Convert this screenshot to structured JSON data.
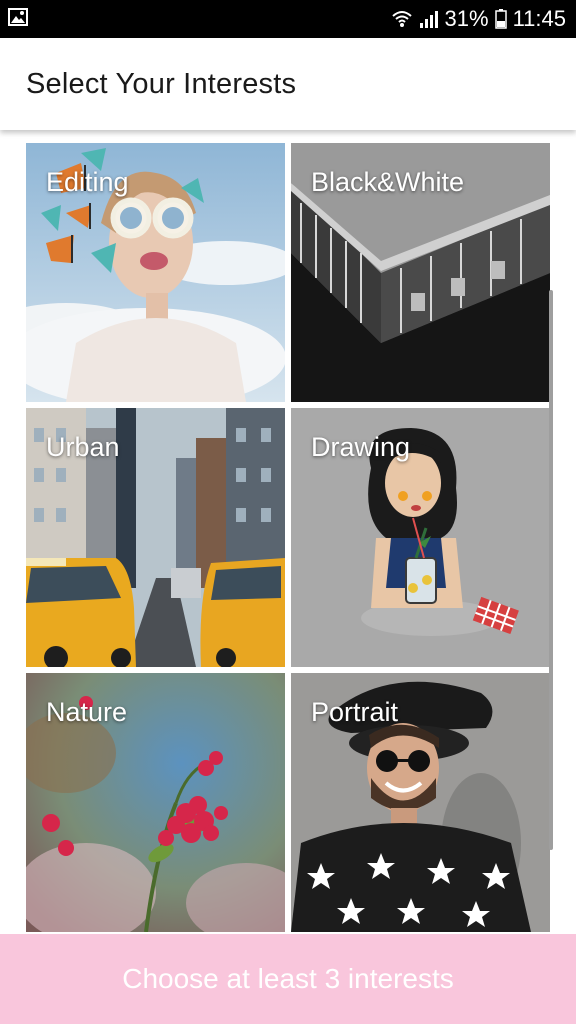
{
  "status_bar": {
    "battery": "31%",
    "time": "11:45",
    "icons": [
      "gallery-icon",
      "wifi-icon",
      "signal-icon",
      "battery-icon"
    ]
  },
  "header": {
    "title": "Select Your Interests"
  },
  "interests": [
    {
      "label": "Editing"
    },
    {
      "label": "Black&White"
    },
    {
      "label": "Urban"
    },
    {
      "label": "Drawing"
    },
    {
      "label": "Nature"
    },
    {
      "label": "Portrait"
    }
  ],
  "cta": {
    "label": "Choose at least 3 interests"
  },
  "colors": {
    "cta_background": "#f9c6dc",
    "status_bar": "#000000",
    "header_background": "#ffffff"
  }
}
